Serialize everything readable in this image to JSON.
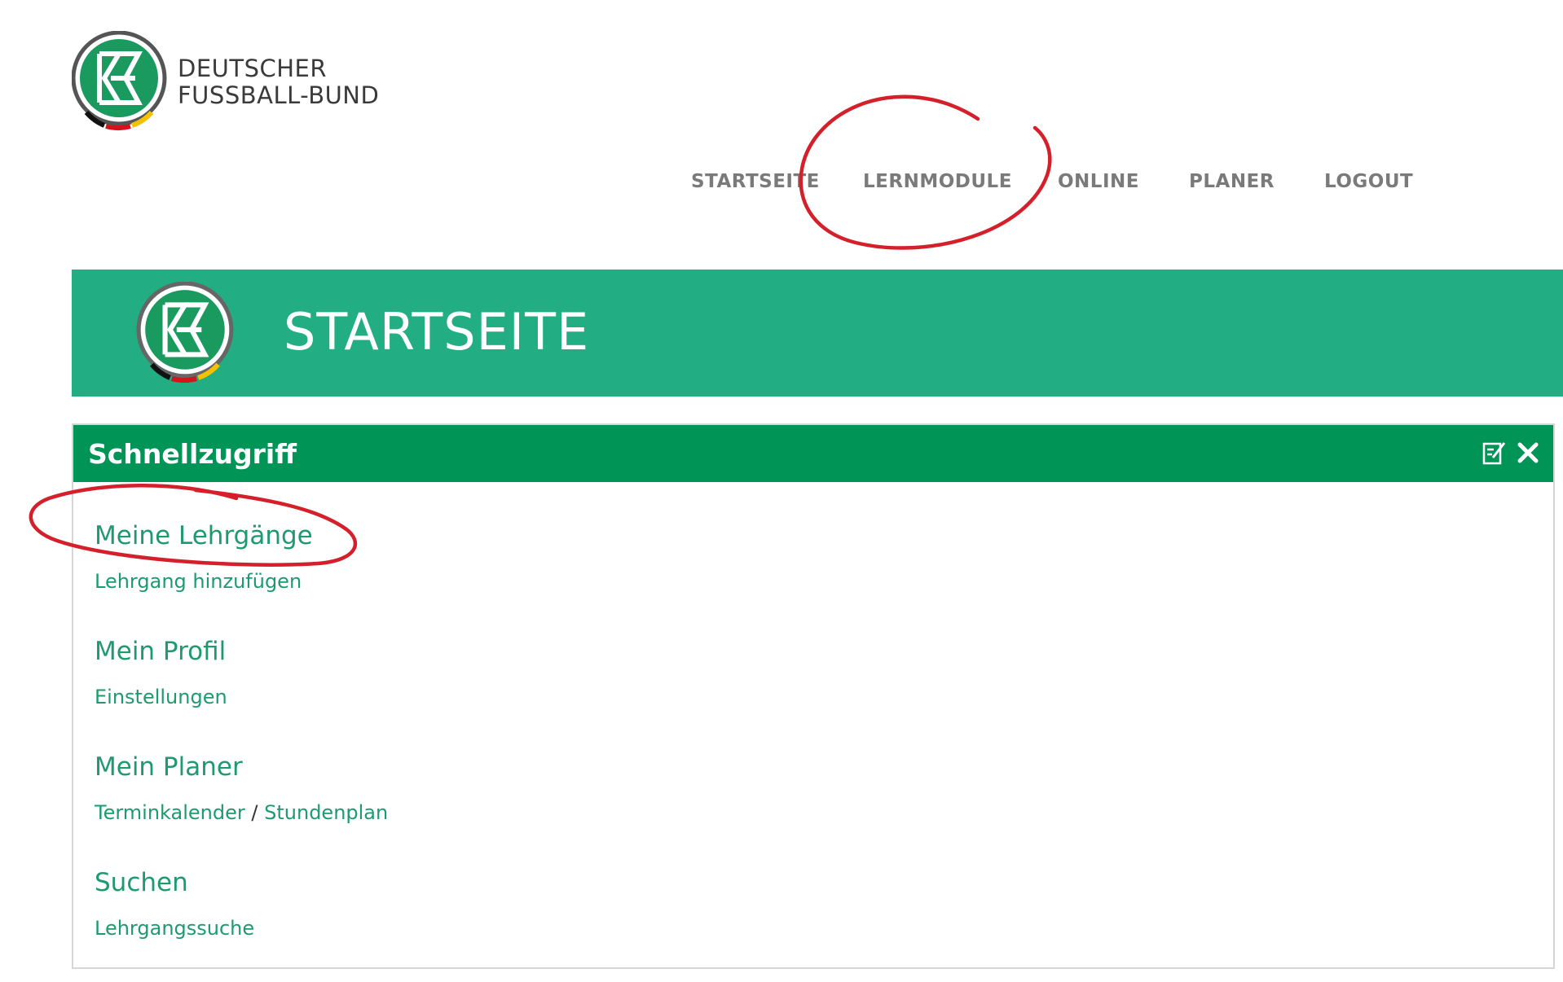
{
  "logo": {
    "line1": "DEUTSCHER",
    "line2": "FUSSBALL-BUND"
  },
  "nav": {
    "items": [
      {
        "label": "STARTSEITE"
      },
      {
        "label": "LERNMODULE"
      },
      {
        "label": "ONLINE"
      },
      {
        "label": "PLANER"
      },
      {
        "label": "LOGOUT"
      }
    ]
  },
  "hero": {
    "title": "STARTSEITE"
  },
  "panel": {
    "title": "Schnellzugriff",
    "sections": [
      {
        "title": "Meine Lehrgänge",
        "links": [
          "Lehrgang hinzufügen"
        ]
      },
      {
        "title": "Mein Profil",
        "links": [
          "Einstellungen"
        ]
      },
      {
        "title": "Mein Planer",
        "links": [
          "Terminkalender",
          "Stundenplan"
        ],
        "separator": "/"
      },
      {
        "title": "Suchen",
        "links": [
          "Lehrgangssuche"
        ]
      }
    ]
  },
  "colors": {
    "hero_green": "#22ae82",
    "panel_header_green": "#009557",
    "link_green": "#1e9a6e",
    "nav_gray": "#7a7a7a",
    "annotation_red": "#d4202a"
  },
  "icons": {
    "panel_edit": "edit-note-icon",
    "panel_close": "close-icon",
    "logo": "dfb-logo-icon"
  }
}
